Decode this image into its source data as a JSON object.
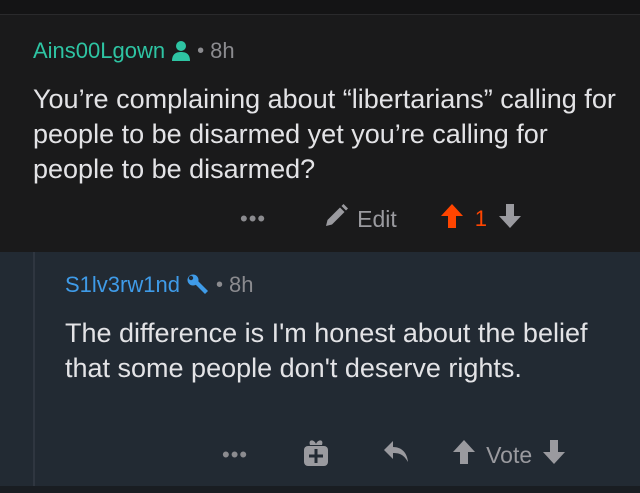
{
  "comment_parent": {
    "author": "Ains00Lgown",
    "separator": "•",
    "time": "8h",
    "body": "You’re complaining about “libertarians” calling for people to be disarmed yet you’re calling for people to be disarmed?",
    "more_label": "•••",
    "edit_label": "Edit",
    "vote_count": "1",
    "upvoted": true,
    "author_icon": "person-icon",
    "colors": {
      "author": "#2ec4a3",
      "upvote": "#ff4500"
    }
  },
  "comment_reply": {
    "author": "S1lv3rw1nd",
    "separator": "•",
    "time": "8h",
    "body": "The difference is I'm honest about the belief that some people don't deserve rights.",
    "more_label": "•••",
    "vote_label": "Vote",
    "author_icon": "wrench-icon",
    "colors": {
      "author": "#3f9be8"
    }
  }
}
